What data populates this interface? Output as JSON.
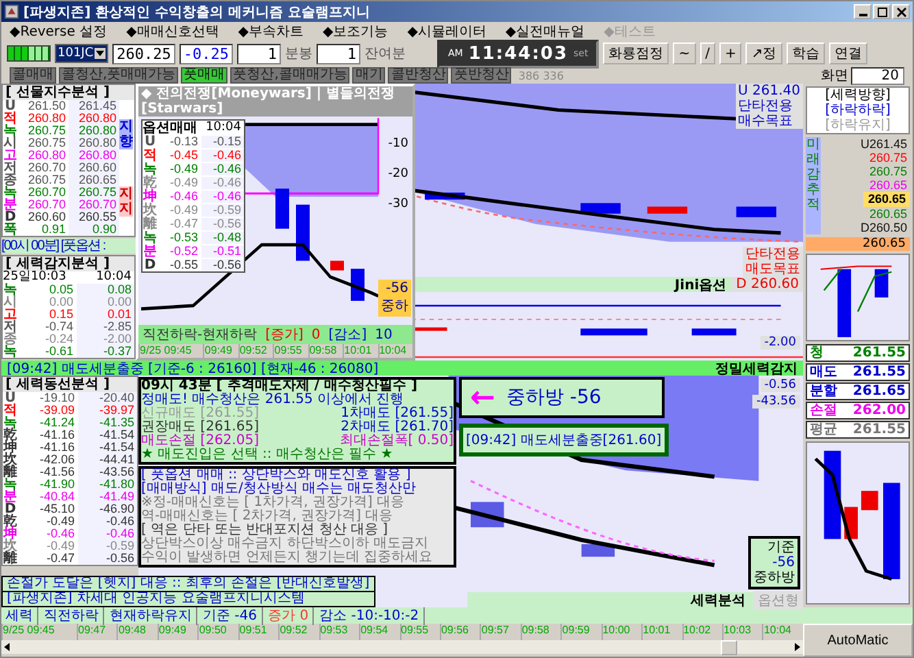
{
  "window": {
    "title": "[파생지존] 환상적인 수익창출의 메커니즘 요술램프지니"
  },
  "menu": [
    {
      "label": "◆Reverse 설정",
      "disabled": false
    },
    {
      "label": "◆매매신호선택",
      "disabled": false
    },
    {
      "label": "◆부속차트",
      "disabled": false
    },
    {
      "label": "◆보조기능",
      "disabled": false
    },
    {
      "label": "◆시뮬레이터",
      "disabled": false
    },
    {
      "label": "◆실전매뉴얼",
      "disabled": false
    },
    {
      "label": "◆테스트",
      "disabled": true
    }
  ],
  "toolbar": {
    "symbol": "101JC",
    "price": "260.25",
    "change": "-0.25",
    "interval": "1",
    "interval_unit": "분봉",
    "remain": "1",
    "remain_unit": "잔여분",
    "clock": {
      "ampm": "AM",
      "time": "11:44:03",
      "set": "set"
    },
    "buttons": [
      "화룡점정",
      "~",
      "/",
      "+",
      "↗정",
      "학습",
      "연결"
    ]
  },
  "signals": {
    "tags": [
      {
        "label": "콜매매",
        "selected": false
      },
      {
        "label": "콜청산,풋매매가능",
        "selected": false
      },
      {
        "label": "풋매매",
        "selected": true
      },
      {
        "label": "풋청산,콜매매가능",
        "selected": false
      },
      {
        "label": "매기",
        "selected": false
      },
      {
        "label": "콜반청산",
        "selected": false
      },
      {
        "label": "풋반청산",
        "selected": false
      }
    ],
    "count": "386 336",
    "screen_label": "화면",
    "screen_value": "20"
  },
  "futures_panel": {
    "title": "[ 선물지수분석 ]",
    "side_top": "지향",
    "side_bottom": "지지",
    "rows": [
      {
        "label": "U",
        "a": "261.50",
        "b": "261.45",
        "color": "#555555"
      },
      {
        "label": "적",
        "a": "260.80",
        "b": "260.80",
        "color": "#ff0000"
      },
      {
        "label": "녹",
        "a": "260.75",
        "b": "260.80",
        "color": "#008000"
      },
      {
        "label": "시",
        "a": "260.75",
        "b": "260.80",
        "color": "#555555"
      },
      {
        "label": "고",
        "a": "260.80",
        "b": "260.80",
        "color": "#ee00ee"
      },
      {
        "label": "저",
        "a": "260.70",
        "b": "260.60",
        "color": "#555555"
      },
      {
        "label": "종",
        "a": "260.75",
        "b": "260.65",
        "color": "#555555"
      },
      {
        "label": "녹",
        "a": "260.70",
        "b": "260.75",
        "color": "#008000"
      },
      {
        "label": "분",
        "a": "260.70",
        "b": "260.70",
        "color": "#ee00ee"
      },
      {
        "label": "D",
        "a": "260.60",
        "b": "260.55",
        "color": "#333333"
      },
      {
        "label": "폭",
        "a": "0.91",
        "b": "0.90",
        "color": "#008000"
      }
    ]
  },
  "put_bar": "[00시 00분] [풋옵션 :",
  "power_panel": {
    "title": "[ 세력감지분석 ]",
    "head_a": "25일10:03",
    "head_b": "10:04",
    "rows": [
      {
        "label": "녹",
        "a": "0.05",
        "b": "0.08",
        "color": "#008000"
      },
      {
        "label": "시",
        "a": "0.00",
        "b": "0.00",
        "color": "#888888"
      },
      {
        "label": "고",
        "a": "0.15",
        "b": "0.01",
        "color": "#ff0000"
      },
      {
        "label": "저",
        "a": "-0.74",
        "b": "-2.85",
        "color": "#555555"
      },
      {
        "label": "종",
        "a": "-0.24",
        "b": "-2.00",
        "color": "#888888"
      },
      {
        "label": "녹",
        "a": "-0.61",
        "b": "-0.37",
        "color": "#008000"
      }
    ]
  },
  "popup": {
    "title": "◆ 전의전쟁[Moneywars] | 별들의전쟁[Starwars]",
    "table_title": "옵션매매",
    "table_time": "10:04",
    "rows": [
      {
        "label": "U",
        "a": "-0.13",
        "b": "-0.15",
        "color": "#555555"
      },
      {
        "label": "적",
        "a": "-0.45",
        "b": "-0.46",
        "color": "#ff0000"
      },
      {
        "label": "녹",
        "a": "-0.49",
        "b": "-0.46",
        "color": "#008000"
      },
      {
        "label": "乾",
        "a": "-0.49",
        "b": "-0.46",
        "color": "#888888"
      },
      {
        "label": "坤",
        "a": "-0.46",
        "b": "-0.46",
        "color": "#ee00ee"
      },
      {
        "label": "坎",
        "a": "-0.49",
        "b": "-0.59",
        "color": "#888888"
      },
      {
        "label": "離",
        "a": "-0.47",
        "b": "-0.56",
        "color": "#888888"
      },
      {
        "label": "녹",
        "a": "-0.53",
        "b": "-0.48",
        "color": "#008000"
      },
      {
        "label": "분",
        "a": "-0.52",
        "b": "-0.51",
        "color": "#ee00ee"
      },
      {
        "label": "D",
        "a": "-0.55",
        "b": "-0.56",
        "color": "#333333"
      }
    ],
    "y_labels": [
      "-10",
      "-20",
      "-30"
    ],
    "badge_value": "-56",
    "badge_text": "중하",
    "footer": {
      "label": "직전하락-현재하락",
      "up_label": "[증가]",
      "up_value": "0",
      "down_label": "[감소]",
      "down_value": "10"
    },
    "times": [
      "9/25 09:45",
      "09:49",
      "09:52",
      "09:55",
      "09:58",
      "10:01",
      "10:04"
    ]
  },
  "upper_chart": {
    "top_value": "U 261.40",
    "top_line1": "단타전용",
    "top_line2": "매수목표",
    "bottom_line1": "단타전용",
    "bottom_line2": "매도목표",
    "strip_label": "Jini옵션",
    "strip_value": "D 260.60",
    "sub_value": "-2.00"
  },
  "sell_bar": {
    "text": "[09:42] 매도세분출중 [기준-6 : 26160] [현재-46 : 26080]",
    "right": "정밀세력감지"
  },
  "flow_panel": {
    "title": "[ 세력동선분석 ]",
    "rows": [
      {
        "label": "U",
        "a": "-19.10",
        "b": "-20.40",
        "color": "#555555"
      },
      {
        "label": "적",
        "a": "-39.09",
        "b": "-39.97",
        "color": "#ff0000"
      },
      {
        "label": "녹",
        "a": "-41.24",
        "b": "-41.35",
        "color": "#008000"
      },
      {
        "label": "乾",
        "a": "-41.16",
        "b": "-41.54",
        "color": "#333333"
      },
      {
        "label": "坤",
        "a": "-41.16",
        "b": "-41.54",
        "color": "#333333"
      },
      {
        "label": "坎",
        "a": "-42.06",
        "b": "-44.41",
        "color": "#333333"
      },
      {
        "label": "離",
        "a": "-41.56",
        "b": "-43.56",
        "color": "#333333"
      },
      {
        "label": "녹",
        "a": "-41.90",
        "b": "-41.80",
        "color": "#008000"
      },
      {
        "label": "분",
        "a": "-40.84",
        "b": "-41.49",
        "color": "#ee00ee"
      },
      {
        "label": "D",
        "a": "-45.10",
        "b": "-46.90",
        "color": "#333333"
      },
      {
        "label": "乾",
        "a": "-0.49",
        "b": "-0.46",
        "color": "#333333"
      },
      {
        "label": "坤",
        "a": "-0.46",
        "b": "-0.46",
        "color": "#ee00ee"
      },
      {
        "label": "坎",
        "a": "-0.49",
        "b": "-0.59",
        "color": "#888888"
      },
      {
        "label": "離",
        "a": "-0.47",
        "b": "-0.56",
        "color": "#333333"
      }
    ]
  },
  "info_box": {
    "header": "09시 43분 [ 추격매도자제 / 매수청산필수 ]",
    "lines": [
      {
        "cells": [
          {
            "text": "정매도! 매수청산은 261.55 이상에서 진행",
            "color": "#0000cc"
          }
        ]
      },
      {
        "cells": [
          {
            "text": "신규매도 [261.55]",
            "color": "#999999"
          },
          {
            "text": "1차매도 [261.55]",
            "color": "#0000cc"
          }
        ]
      },
      {
        "cells": [
          {
            "text": "권장매도 [261.65]",
            "color": "#333333"
          },
          {
            "text": "2차매도 [261.70]",
            "color": "#0000cc"
          }
        ]
      },
      {
        "cells": [
          {
            "text": "매도손절 [262.05]",
            "color": "#cc00cc"
          },
          {
            "text": "최대손절폭[ 0.50]",
            "color": "#cc00cc"
          }
        ]
      },
      {
        "cells": [
          {
            "text": "★ 매도진입은 선택 :: 매수청산은 필수 ★",
            "color": "#007700"
          }
        ]
      }
    ]
  },
  "guide_box": {
    "lines": [
      {
        "text": "[ 풋옵션 매매 :: 상단박스와 매도신호 활용 ]",
        "color": "#0000cc"
      },
      {
        "text": "[매매방식] 매도/청산방식 매수는 매도청산만",
        "color": "#0000cc"
      },
      {
        "text": "※정-매매신호는 [ 1차가격, 권장가격] 대응",
        "color": "#777777"
      },
      {
        "text": "역-매매신호는 [ 2차가격, 권장가격] 대응",
        "color": "#777777"
      },
      {
        "text": "[ 역은 단타 또는 반대포지션 청산 대응 ]",
        "color": "#333333"
      },
      {
        "text": "상단박스이상 매수금지  하단박스이하 매도금지",
        "color": "#777777"
      },
      {
        "text": "수익이 발생하면 언제든지 챙기는데 집중하세요",
        "color": "#777777"
      }
    ]
  },
  "arrow_box": {
    "arrow": "←",
    "text": "중하방 -56",
    "sub": "[09:42] 매도세분출중[261.60]"
  },
  "lower_chart": {
    "value1": "-0.56",
    "value2": "-43.56",
    "base_label": "기준",
    "base_value": "-56",
    "base_text": "중하방",
    "strip_label": "세력분석",
    "strip_value": "옵션형"
  },
  "notes": [
    "손절가 도달은 [헷지] 대응 :: 최후의 손절은 [반대신호발생]",
    "[파생지존] 차세대 인공지능 요술램프지니시스템"
  ],
  "direction": {
    "title": "[세력방향]",
    "state": "[하락하락]",
    "hint": "[하락유지]",
    "vertical": "미래감추적",
    "values": [
      {
        "text": "U261.45",
        "color": "#111111"
      },
      {
        "text": "260.75",
        "color": "#ff0000"
      },
      {
        "text": "260.75",
        "color": "#008000"
      },
      {
        "text": "260.65",
        "color": "#ee00ee"
      },
      {
        "text": "260.65",
        "color": "#000000"
      },
      {
        "text": "260.65",
        "color": "#008000"
      },
      {
        "text": "D260.50",
        "color": "#111111"
      }
    ],
    "current": "260.65"
  },
  "orders": [
    {
      "label": "청",
      "value": "261.55",
      "color": "#008000"
    },
    {
      "label": "매도",
      "value": "261.55",
      "color": "#0000cc"
    },
    {
      "label": "분할",
      "value": "261.65",
      "color": "#0000cc"
    },
    {
      "label": "손절",
      "value": "262.00",
      "color": "#ee00ee"
    },
    {
      "label": "평균",
      "value": "261.55",
      "color": "#777777"
    }
  ],
  "status": [
    {
      "text": "세력",
      "color": "#0000cc"
    },
    {
      "text": "직전하락",
      "color": "#0000cc"
    },
    {
      "text": "현재하락유지",
      "color": "#0000cc"
    },
    {
      "text": "기준 -46",
      "color": "#0000cc"
    },
    {
      "text": "증가 0",
      "color": "#ff3333"
    },
    {
      "text": "감소 -10:-10:-2",
      "color": "#0000cc"
    }
  ],
  "times": [
    "9/25 09:45",
    "09:47",
    "09:48",
    "09:49",
    "09:50",
    "09:51",
    "09:52",
    "09:53",
    "09:54",
    "09:55",
    "09:56",
    "09:57",
    "09:58",
    "09:59",
    "10:00",
    "10:01",
    "10:02",
    "10:03",
    "10:04"
  ],
  "auto_button": "AutoMatic"
}
